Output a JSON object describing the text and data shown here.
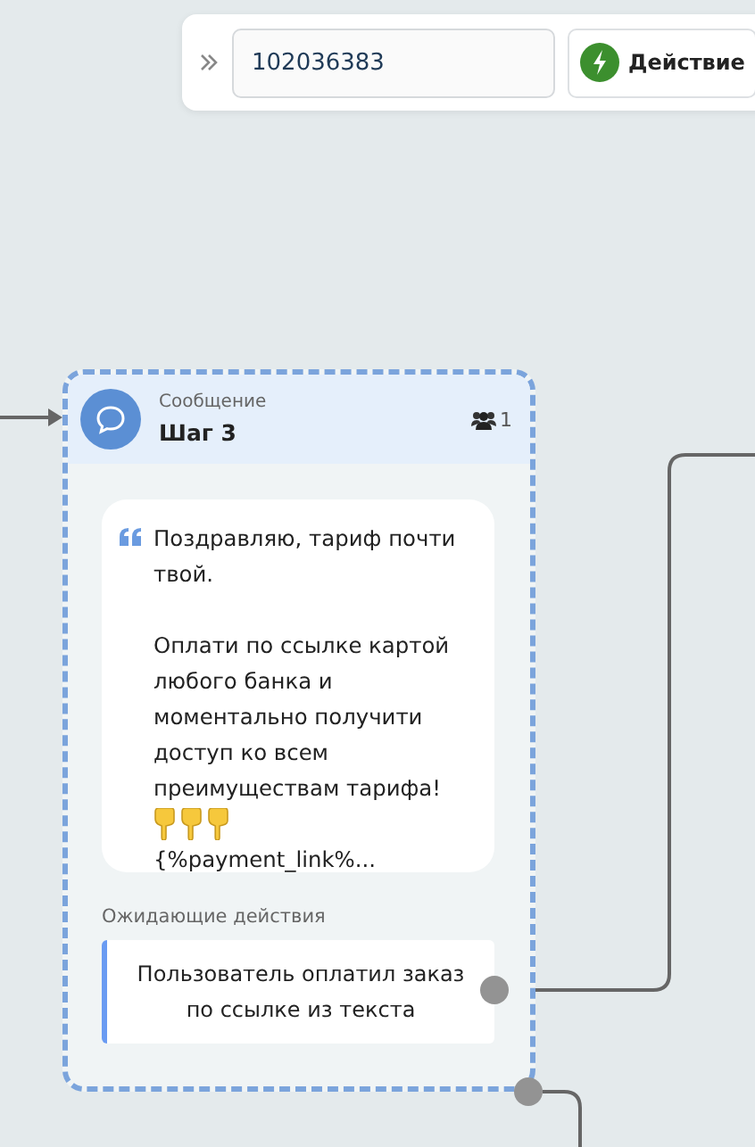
{
  "toolbar": {
    "search": {
      "value": "102036383"
    },
    "action_button": {
      "label": "Действие"
    }
  },
  "node": {
    "type": "Сообщение",
    "title": "Шаг 3",
    "subscribers": "1",
    "message": {
      "text": "Поздравляю, тариф почти твой.\n\nОплати по ссылке картой любого банка и моментально получити доступ ко всем преимуществам тарифа!",
      "link": "{%payment_link%..."
    },
    "waiting_label": "Ожидающие действия",
    "actions": [
      {
        "label": "Пользователь оплатил заказ по ссылке из текста"
      }
    ]
  }
}
